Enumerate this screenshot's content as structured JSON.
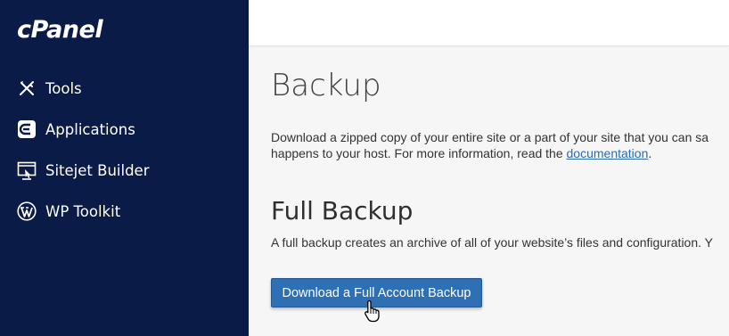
{
  "sidebar": {
    "logo": "cPanel",
    "items": [
      {
        "label": "Tools",
        "icon": "tools-icon"
      },
      {
        "label": "Applications",
        "icon": "applications-icon"
      },
      {
        "label": "Sitejet Builder",
        "icon": "sitejet-icon"
      },
      {
        "label": "WP Toolkit",
        "icon": "wordpress-icon"
      }
    ],
    "background_color": "#0b1b47"
  },
  "main": {
    "title": "Backup",
    "description_line1": "Download a zipped copy of your entire site or a part of your site that you can sa",
    "description_line2_prefix": "happens to your host. For more information, read the ",
    "documentation_link": "documentation",
    "description_line2_suffix": ".",
    "full_backup": {
      "title": "Full Backup",
      "description": "A full backup creates an archive of all of your website’s files and configuration. Y",
      "button_label": "Download a Full Account Backup",
      "button_color": "#2f6fb3"
    }
  }
}
